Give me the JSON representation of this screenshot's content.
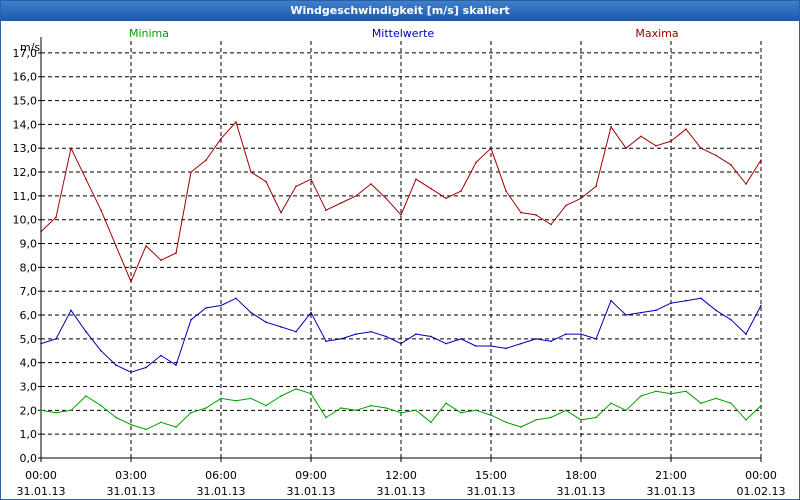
{
  "window": {
    "title": "Windgeschwindigkeit [m/s] skaliert"
  },
  "chart_data": {
    "type": "line",
    "title": "Windgeschwindigkeit [m/s] skaliert",
    "ylabel": "m/s",
    "xlabel": "",
    "ylim": [
      0,
      17.5
    ],
    "yticks": [
      0,
      1,
      2,
      3,
      4,
      5,
      6,
      7,
      8,
      9,
      10,
      11,
      12,
      13,
      14,
      15,
      16,
      17
    ],
    "ytick_labels": [
      "0,0",
      "1,0",
      "2,0",
      "3,0",
      "4,0",
      "5,0",
      "6,0",
      "7,0",
      "8,0",
      "9,0",
      "10,0",
      "11,0",
      "12,0",
      "13,0",
      "14,0",
      "15,0",
      "16,0",
      "17,0"
    ],
    "xlim": [
      0,
      24
    ],
    "xticks": [
      0,
      3,
      6,
      9,
      12,
      15,
      18,
      21,
      24
    ],
    "xtick_time_labels": [
      "00:00",
      "03:00",
      "06:00",
      "09:00",
      "12:00",
      "15:00",
      "18:00",
      "21:00",
      "00:00"
    ],
    "xtick_date_labels": [
      "31.01.13",
      "31.01.13",
      "31.01.13",
      "31.01.13",
      "31.01.13",
      "31.01.13",
      "31.01.13",
      "31.01.13",
      "01.02.13"
    ],
    "grid": true,
    "legend_placement": "top",
    "series": [
      {
        "name": "Minima",
        "color": "#00a000",
        "x": [
          0,
          0.5,
          1,
          1.5,
          2,
          2.5,
          3,
          3.5,
          4,
          4.5,
          5,
          5.5,
          6,
          6.5,
          7,
          7.5,
          8,
          8.5,
          9,
          9.5,
          10,
          10.5,
          11,
          11.5,
          12,
          12.5,
          13,
          13.5,
          14,
          14.5,
          15,
          15.5,
          16,
          16.5,
          17,
          17.5,
          18,
          18.5,
          19,
          19.5,
          20,
          20.5,
          21,
          21.5,
          22,
          22.5,
          23,
          23.5,
          24
        ],
        "values": [
          2.0,
          1.9,
          2.0,
          2.6,
          2.2,
          1.7,
          1.4,
          1.2,
          1.5,
          1.3,
          1.9,
          2.1,
          2.5,
          2.4,
          2.5,
          2.2,
          2.6,
          2.9,
          2.7,
          1.7,
          2.1,
          2.0,
          2.2,
          2.1,
          1.9,
          2.0,
          1.5,
          2.3,
          1.9,
          2.0,
          1.8,
          1.5,
          1.3,
          1.6,
          1.7,
          2.0,
          1.6,
          1.7,
          2.3,
          2.0,
          2.6,
          2.8,
          2.7,
          2.8,
          2.3,
          2.5,
          2.3,
          1.6,
          2.2
        ]
      },
      {
        "name": "Mittelwerte",
        "color": "#0000b0",
        "x": [
          0,
          0.5,
          1,
          1.5,
          2,
          2.5,
          3,
          3.5,
          4,
          4.5,
          5,
          5.5,
          6,
          6.5,
          7,
          7.5,
          8,
          8.5,
          9,
          9.5,
          10,
          10.5,
          11,
          11.5,
          12,
          12.5,
          13,
          13.5,
          14,
          14.5,
          15,
          15.5,
          16,
          16.5,
          17,
          17.5,
          18,
          18.5,
          19,
          19.5,
          20,
          20.5,
          21,
          21.5,
          22,
          22.5,
          23,
          23.5,
          24
        ],
        "values": [
          4.8,
          5.0,
          6.2,
          5.3,
          4.5,
          3.9,
          3.6,
          3.8,
          4.3,
          3.9,
          5.8,
          6.3,
          6.4,
          6.7,
          6.1,
          5.7,
          5.5,
          5.3,
          6.1,
          4.9,
          5.0,
          5.2,
          5.3,
          5.1,
          4.8,
          5.2,
          5.1,
          4.8,
          5.0,
          4.7,
          4.7,
          4.6,
          4.8,
          5.0,
          4.9,
          5.2,
          5.2,
          5.0,
          6.6,
          6.0,
          6.1,
          6.2,
          6.5,
          6.6,
          6.7,
          6.2,
          5.8,
          5.2,
          6.4
        ]
      },
      {
        "name": "Maxima",
        "color": "#a00000",
        "x": [
          0,
          0.5,
          1,
          1.5,
          2,
          2.5,
          3,
          3.5,
          4,
          4.5,
          5,
          5.5,
          6,
          6.5,
          7,
          7.5,
          8,
          8.5,
          9,
          9.5,
          10,
          10.5,
          11,
          11.5,
          12,
          12.5,
          13,
          13.5,
          14,
          14.5,
          15,
          15.5,
          16,
          16.5,
          17,
          17.5,
          18,
          18.5,
          19,
          19.5,
          20,
          20.5,
          21,
          21.5,
          22,
          22.5,
          23,
          23.5,
          24
        ],
        "values": [
          9.5,
          10.1,
          13.0,
          11.7,
          10.4,
          8.9,
          7.4,
          8.9,
          8.3,
          8.6,
          12.0,
          12.5,
          13.4,
          14.1,
          12.0,
          11.6,
          10.3,
          11.4,
          11.7,
          10.4,
          10.7,
          11.0,
          11.5,
          10.9,
          10.2,
          11.7,
          11.3,
          10.9,
          11.2,
          12.4,
          13.0,
          11.2,
          10.3,
          10.2,
          9.8,
          10.6,
          10.9,
          11.4,
          13.9,
          13.0,
          13.5,
          13.1,
          13.3,
          13.8,
          13.0,
          12.7,
          12.3,
          11.5,
          12.5
        ]
      }
    ]
  }
}
